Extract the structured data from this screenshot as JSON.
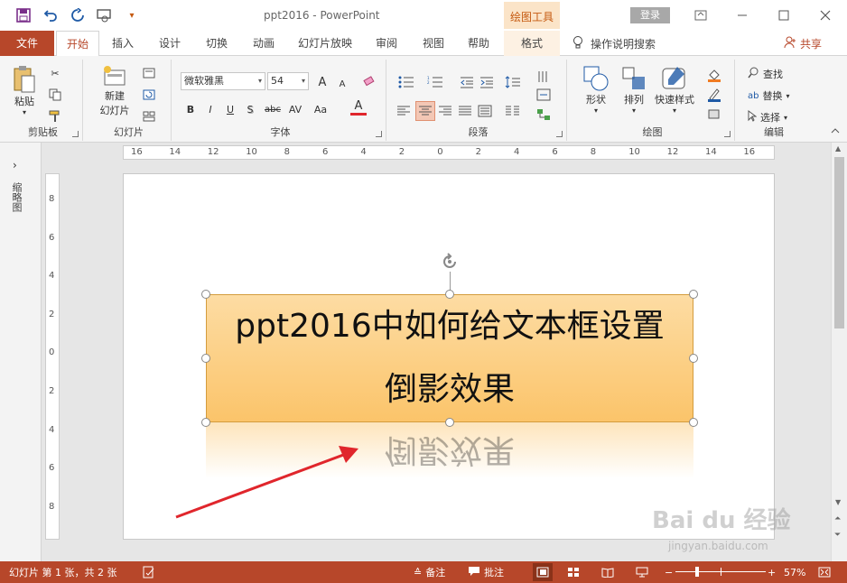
{
  "window": {
    "doc_title": "ppt2016  -  PowerPoint",
    "context_tab_header": "绘图工具",
    "login_label": "登录"
  },
  "tabs": {
    "file": "文件",
    "items": [
      "开始",
      "插入",
      "设计",
      "切换",
      "动画",
      "幻灯片放映",
      "审阅",
      "视图",
      "帮助"
    ],
    "context": "格式",
    "tell_me": "操作说明搜索",
    "share": "共享"
  },
  "ribbon": {
    "clipboard": {
      "label": "剪贴板",
      "paste": "粘贴"
    },
    "slides": {
      "label": "幻灯片",
      "new_slide_line1": "新建",
      "new_slide_line2": "幻灯片"
    },
    "font": {
      "label": "字体",
      "font_name": "微软雅黑",
      "font_size": "54",
      "bold": "B",
      "italic": "I",
      "underline": "U",
      "shadow": "S",
      "strike": "abc",
      "spacing": "AV",
      "case": "Aa",
      "grow": "A",
      "shrink": "A",
      "color": "A"
    },
    "paragraph": {
      "label": "段落"
    },
    "drawing": {
      "label": "绘图",
      "shapes": "形状",
      "arrange": "排列",
      "quick_styles": "快速样式"
    },
    "editing": {
      "label": "编辑",
      "find": "查找",
      "replace": "替换",
      "select": "选择"
    }
  },
  "side_panel": {
    "label": "缩略图"
  },
  "ruler": {
    "h_ticks": [
      "16",
      "14",
      "12",
      "10",
      "8",
      "6",
      "4",
      "2",
      "0",
      "2",
      "4",
      "6",
      "8",
      "10",
      "12",
      "14",
      "16"
    ],
    "v_ticks": [
      "8",
      "6",
      "4",
      "2",
      "0",
      "2",
      "4",
      "6",
      "8"
    ]
  },
  "slide": {
    "title_line1": "ppt2016中如何给文本框设置",
    "title_line2": "倒影效果",
    "reflection_text": "倒影效果"
  },
  "watermark": {
    "main": "Bai du 经验",
    "sub": "jingyan.baidu.com"
  },
  "status": {
    "slide_info": "幻灯片 第 1 张，共 2 张",
    "notes": "备注",
    "comments": "批注",
    "zoom": "57%"
  },
  "colors": {
    "accent": "#b7472a",
    "textbox_fill": "#fbc46a",
    "arrow": "#e0262c"
  }
}
